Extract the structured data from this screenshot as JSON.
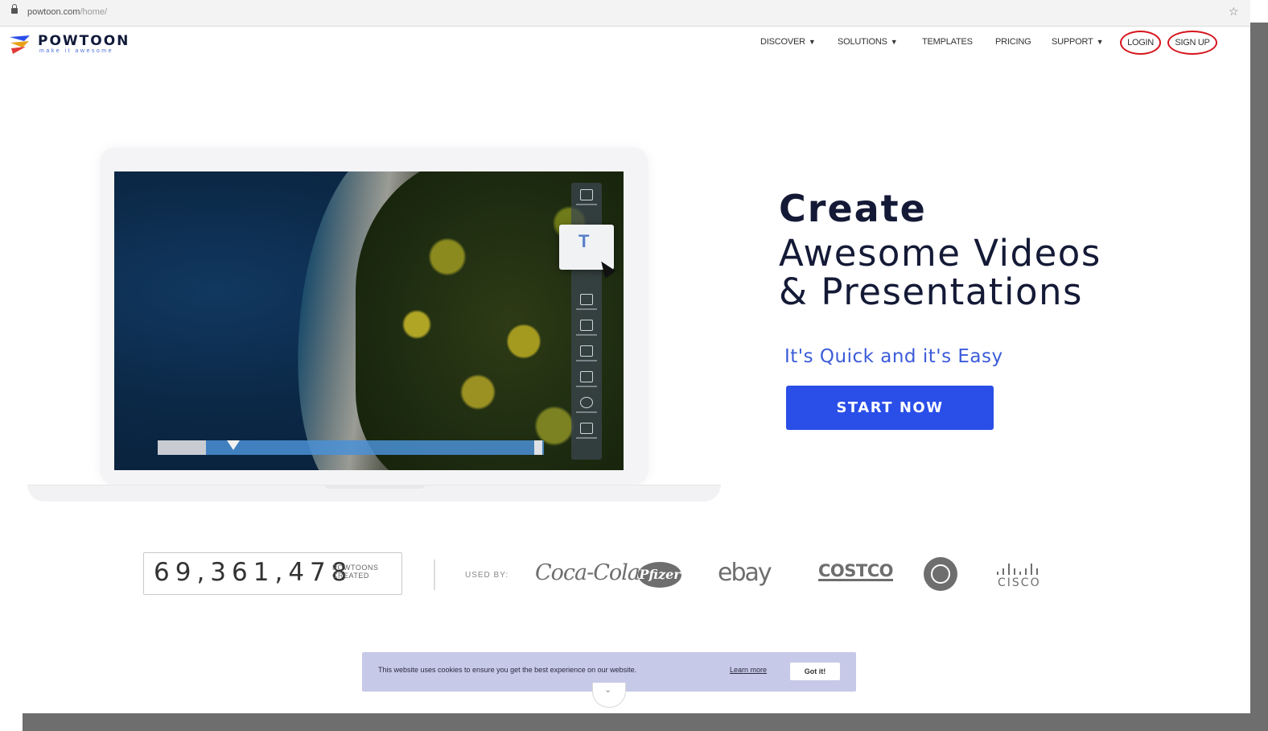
{
  "browser": {
    "url_host": "powtoon.com",
    "url_path": "/home/"
  },
  "header": {
    "logo_text": "POWTOON",
    "logo_tagline": "make it awesome",
    "nav": {
      "discover": "DISCOVER",
      "solutions": "SOLUTIONS",
      "templates": "TEMPLATES",
      "pricing": "PRICING",
      "support": "SUPPORT",
      "login": "LOGIN",
      "signup": "SIGN UP"
    }
  },
  "hero": {
    "headline_bold": "Create",
    "headline_line2": "Awesome Videos",
    "headline_line3": "& Presentations",
    "subheadline": "It's Quick and it's Easy",
    "cta_label": "START NOW"
  },
  "stats": {
    "counter_value": "69,361,478",
    "counter_label_1": "POWTOONS",
    "counter_label_2": "CREATED",
    "used_by_label": "USED BY:",
    "brands": {
      "coca_cola": "Coca-Cola",
      "pfizer": "Pfizer",
      "ebay": "ebay",
      "costco": "COSTCO",
      "cisco": "CISCO"
    }
  },
  "cookie_banner": {
    "message": "This website uses cookies to ensure you get the best experience on our website.",
    "learn_more": "Learn more",
    "accept": "Got it!"
  },
  "colors": {
    "brand_blue": "#2a4ee8",
    "navy": "#141a36",
    "accent_blue": "#3b5bd9",
    "highlight_red": "#d6141c",
    "cookie_bg": "#c7c9e8"
  },
  "icons": {
    "lock": "lock-icon",
    "star": "bookmark-star-icon",
    "caret": "caret-down-icon",
    "scroll": "chevron-down-icon"
  }
}
